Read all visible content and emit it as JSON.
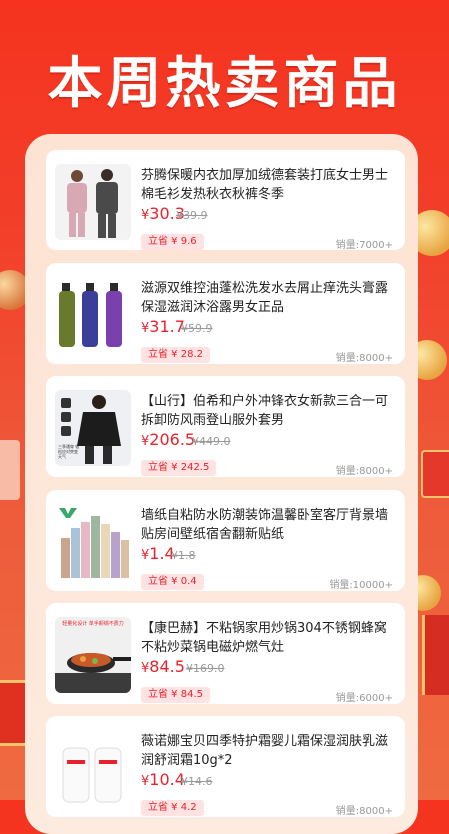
{
  "headline": "本周热卖商品",
  "products": [
    {
      "title": "芬腾保暖内衣加厚加绒德套装打底女士男士棉毛衫发热秋衣秋裤冬季",
      "price_symbol": "¥",
      "price": "30.3",
      "original_price": "¥39.9",
      "save": "立省 ¥ 9.6",
      "sales": "销量:7000+",
      "image": "thermal-underwear-models"
    },
    {
      "title": "滋源双维控油蓬松洗发水去屑止痒洗头膏露保湿滋润沐浴露男女正品",
      "price_symbol": "¥",
      "price": "31.7",
      "original_price": "¥59.9",
      "save": "立省 ¥ 28.2",
      "sales": "销量:8000+",
      "image": "shampoo-bottles"
    },
    {
      "title": "【山行】伯希和户外冲锋衣女新款三合一可拆卸防风雨登山服外套男",
      "price_symbol": "¥",
      "price": "206.5",
      "original_price": "¥449.0",
      "save": "立省 ¥ 242.5",
      "sales": "销量:8000+",
      "image": "outdoor-jacket",
      "image_caption": "三季通穿 轻松应对突变天气"
    },
    {
      "title": "墙纸自粘防水防潮装饰温馨卧室客厅背景墙贴房间壁纸宿舍翻新贴纸",
      "price_symbol": "¥",
      "price": "1.4",
      "original_price": "¥1.8",
      "save": "立省 ¥ 0.4",
      "sales": "销量:10000+",
      "image": "wallpaper-rolls"
    },
    {
      "title": "【康巴赫】不粘锅家用炒锅304不锈钢蜂窝不粘炒菜锅电磁炉燃气灶",
      "price_symbol": "¥",
      "price": "84.5",
      "original_price": "¥169.0",
      "save": "立省 ¥ 84.5",
      "sales": "销量:6000+",
      "image": "wok-pan",
      "image_caption": "轻量化设计 单手颠锅不费力"
    },
    {
      "title": "薇诺娜宝贝四季特护霜婴儿霜保湿润肤乳滋润舒润霜10g*2",
      "price_symbol": "¥",
      "price": "10.4",
      "original_price": "¥14.6",
      "save": "立省 ¥ 4.2",
      "sales": "销量:8000+",
      "image": "baby-cream-tubes"
    }
  ]
}
